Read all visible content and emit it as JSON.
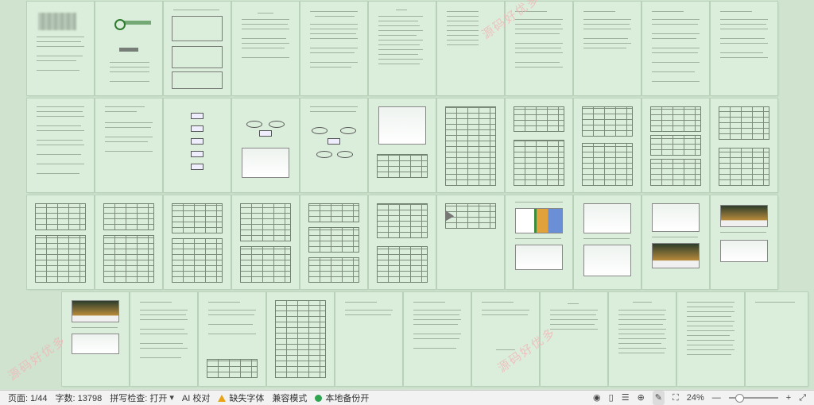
{
  "status_bar": {
    "page_label": "页面: 1/44",
    "word_count_label": "字数: 13798",
    "spell_check_label": "拼写检查: 打开",
    "ai_proofread_label": "AI 校对",
    "missing_font_label": "缺失字体",
    "compat_mode_label": "兼容模式",
    "backup_label": "本地备份开",
    "zoom_value": "24%",
    "zoom_minus": "—",
    "zoom_plus": "+"
  },
  "document": {
    "cover_school": "中国××学院毕业设计",
    "cover_title": "毕业设计",
    "watermark": "源码好优多",
    "total_pages": 44
  },
  "icons": {
    "eye": "eye-icon",
    "book": "book-icon",
    "list": "outline-icon",
    "globe": "web-icon",
    "pen": "edit-icon",
    "fit": "fit-page-icon",
    "fullscreen": "fullscreen-icon"
  }
}
